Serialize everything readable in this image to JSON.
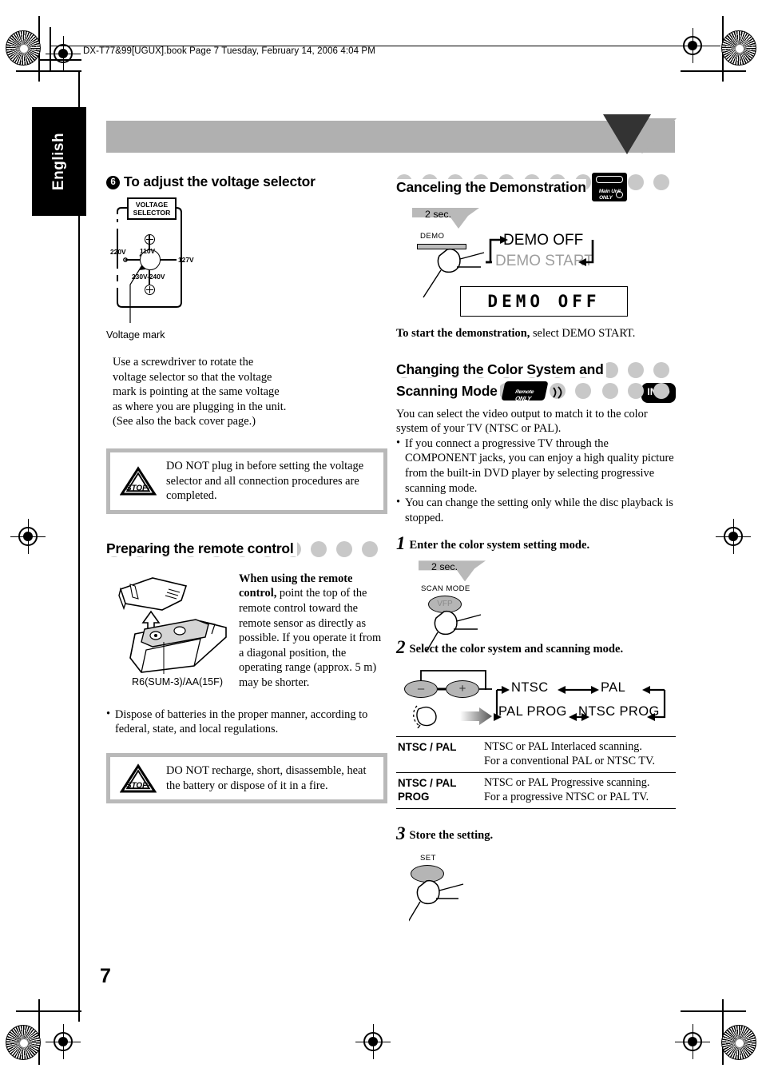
{
  "header": {
    "filename_line": "DX-T77&99[UGUX].book  Page 7  Tuesday, February 14, 2006  4:04 PM"
  },
  "language_tab": {
    "label": "English"
  },
  "page_number": "7",
  "left_column": {
    "section1": {
      "number": "6",
      "heading": "To adjust the voltage selector",
      "body": "Use a screwdriver to rotate the voltage selector so that the voltage mark is pointing at the same voltage as where you are plugging in the unit. (See also the back cover page.)",
      "diagram": {
        "box_label_line1": "VOLTAGE",
        "box_label_line2": "SELECTOR",
        "voltage_110": "110V",
        "voltage_220": "220V",
        "voltage_127": "127V",
        "voltage_230_240": "230V-240V",
        "caption": "Voltage mark"
      }
    },
    "warning1": {
      "icon": "stop-icon",
      "text": "DO NOT plug in before setting the voltage selector and all connection procedures are completed."
    },
    "section2": {
      "heading": "Preparing the remote control",
      "battery_caption": "R6(SUM-3)/AA(15F)",
      "body_bold": "When using the remote control,",
      "body_rest": " point the top of the remote control toward the remote sensor as directly as possible. If you operate it from a diagonal position, the operating range (approx. 5 m) may be shorter.",
      "bullet1": "Dispose of batteries in the proper manner, according to federal, state, and local regulations."
    },
    "warning2": {
      "icon": "stop-icon",
      "text": "DO NOT recharge, short, disassemble, heat the battery or dispose of it in a fire."
    }
  },
  "right_column": {
    "section_demo": {
      "heading": "Canceling the Demonstration",
      "badge_main_unit_line1": "Main Unit",
      "badge_main_unit_line2": "ONLY",
      "hold_time": "2 sec.",
      "button_label": "DEMO",
      "state_off": "DEMO OFF",
      "state_start": "DEMO START",
      "lcd_text": "DEMO OFF",
      "footnote_bold": "To start the demonstration,",
      "footnote_rest": " select DEMO START."
    },
    "section_color": {
      "heading_line1": "Changing the Color System and",
      "heading_line2": "Scanning Mode",
      "badge_remote_line1": "Remote",
      "badge_remote_line2": "ONLY",
      "badge_info": "INFO",
      "intro": "You can select the video output to match it to the color system of your TV (NTSC or PAL).",
      "bullet1": "If you connect a progressive TV through the COMPONENT jacks, you can enjoy a high quality picture from the built-in DVD player by selecting progressive scanning mode.",
      "bullet2": "You can change the setting only while the disc playback is stopped.",
      "step1": {
        "number": "1",
        "title": "Enter the color system setting mode.",
        "hold_time": "2 sec.",
        "button_label": "SCAN MODE",
        "button_text": "VFP"
      },
      "step2": {
        "number": "2",
        "title": "Select the color system and scanning mode.",
        "minus": "–",
        "plus": "+",
        "flow_top": [
          "NTSC",
          "PAL"
        ],
        "flow_bottom": [
          "PAL PROG",
          "NTSC PROG"
        ],
        "table": {
          "rows": [
            {
              "key_line1": "NTSC / PAL",
              "key_line2": "",
              "value_line1": "NTSC or PAL Interlaced scanning.",
              "value_line2": "For a conventional PAL or NTSC TV."
            },
            {
              "key_line1": "NTSC / PAL",
              "key_line2": "PROG",
              "value_line1": "NTSC or PAL Progressive scanning.",
              "value_line2": "For a progressive NTSC or PAL TV."
            }
          ]
        }
      },
      "step3": {
        "number": "3",
        "title": "Store the setting.",
        "button_label": "SET"
      }
    }
  },
  "colors": {
    "band_gray": "#b0b0b0",
    "dot_gray": "#c8c8c8",
    "warn_border": "#b9b9b9",
    "triangle_dark": "#333333",
    "demo_gray_text": "#9e9e9e"
  }
}
